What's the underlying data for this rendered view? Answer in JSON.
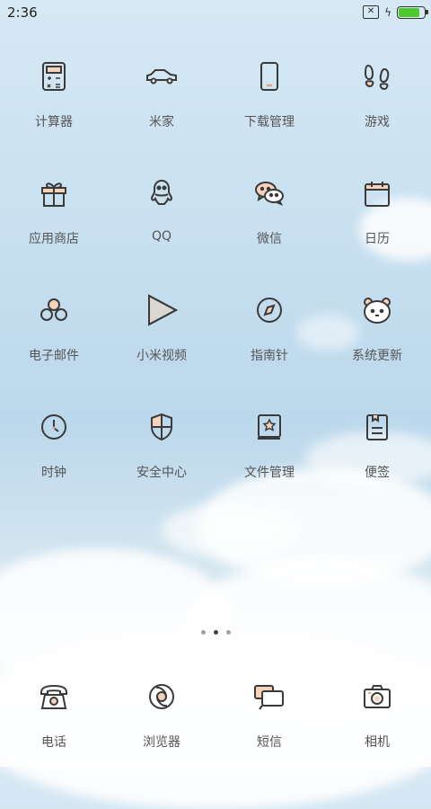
{
  "status_bar": {
    "time": "2:36",
    "battery_level": 0.9,
    "battery_color": "#4fc82b"
  },
  "apps": [
    {
      "label": "计算器",
      "icon": "calculator-icon"
    },
    {
      "label": "米家",
      "icon": "car-icon"
    },
    {
      "label": "下载管理",
      "icon": "phone-device-icon"
    },
    {
      "label": "游戏",
      "icon": "footprints-icon"
    },
    {
      "label": "应用商店",
      "icon": "gift-icon"
    },
    {
      "label": "QQ",
      "icon": "qq-penguin-icon"
    },
    {
      "label": "微信",
      "icon": "wechat-icon"
    },
    {
      "label": "日历",
      "icon": "calendar-icon"
    },
    {
      "label": "电子邮件",
      "icon": "email-icon"
    },
    {
      "label": "小米视频",
      "icon": "play-icon"
    },
    {
      "label": "指南针",
      "icon": "compass-icon"
    },
    {
      "label": "系统更新",
      "icon": "bear-icon"
    },
    {
      "label": "时钟",
      "icon": "clock-icon"
    },
    {
      "label": "安全中心",
      "icon": "shield-icon"
    },
    {
      "label": "文件管理",
      "icon": "star-book-icon"
    },
    {
      "label": "便签",
      "icon": "note-icon"
    }
  ],
  "pager": {
    "pages": 3,
    "active": 1
  },
  "dock": [
    {
      "label": "电话",
      "icon": "telephone-icon"
    },
    {
      "label": "浏览器",
      "icon": "browser-icon"
    },
    {
      "label": "短信",
      "icon": "message-icon"
    },
    {
      "label": "相机",
      "icon": "camera-icon"
    }
  ],
  "colors": {
    "icon_stroke": "#3a3a3a",
    "accent_peach": "#f6d2b8",
    "label": "#555555"
  }
}
